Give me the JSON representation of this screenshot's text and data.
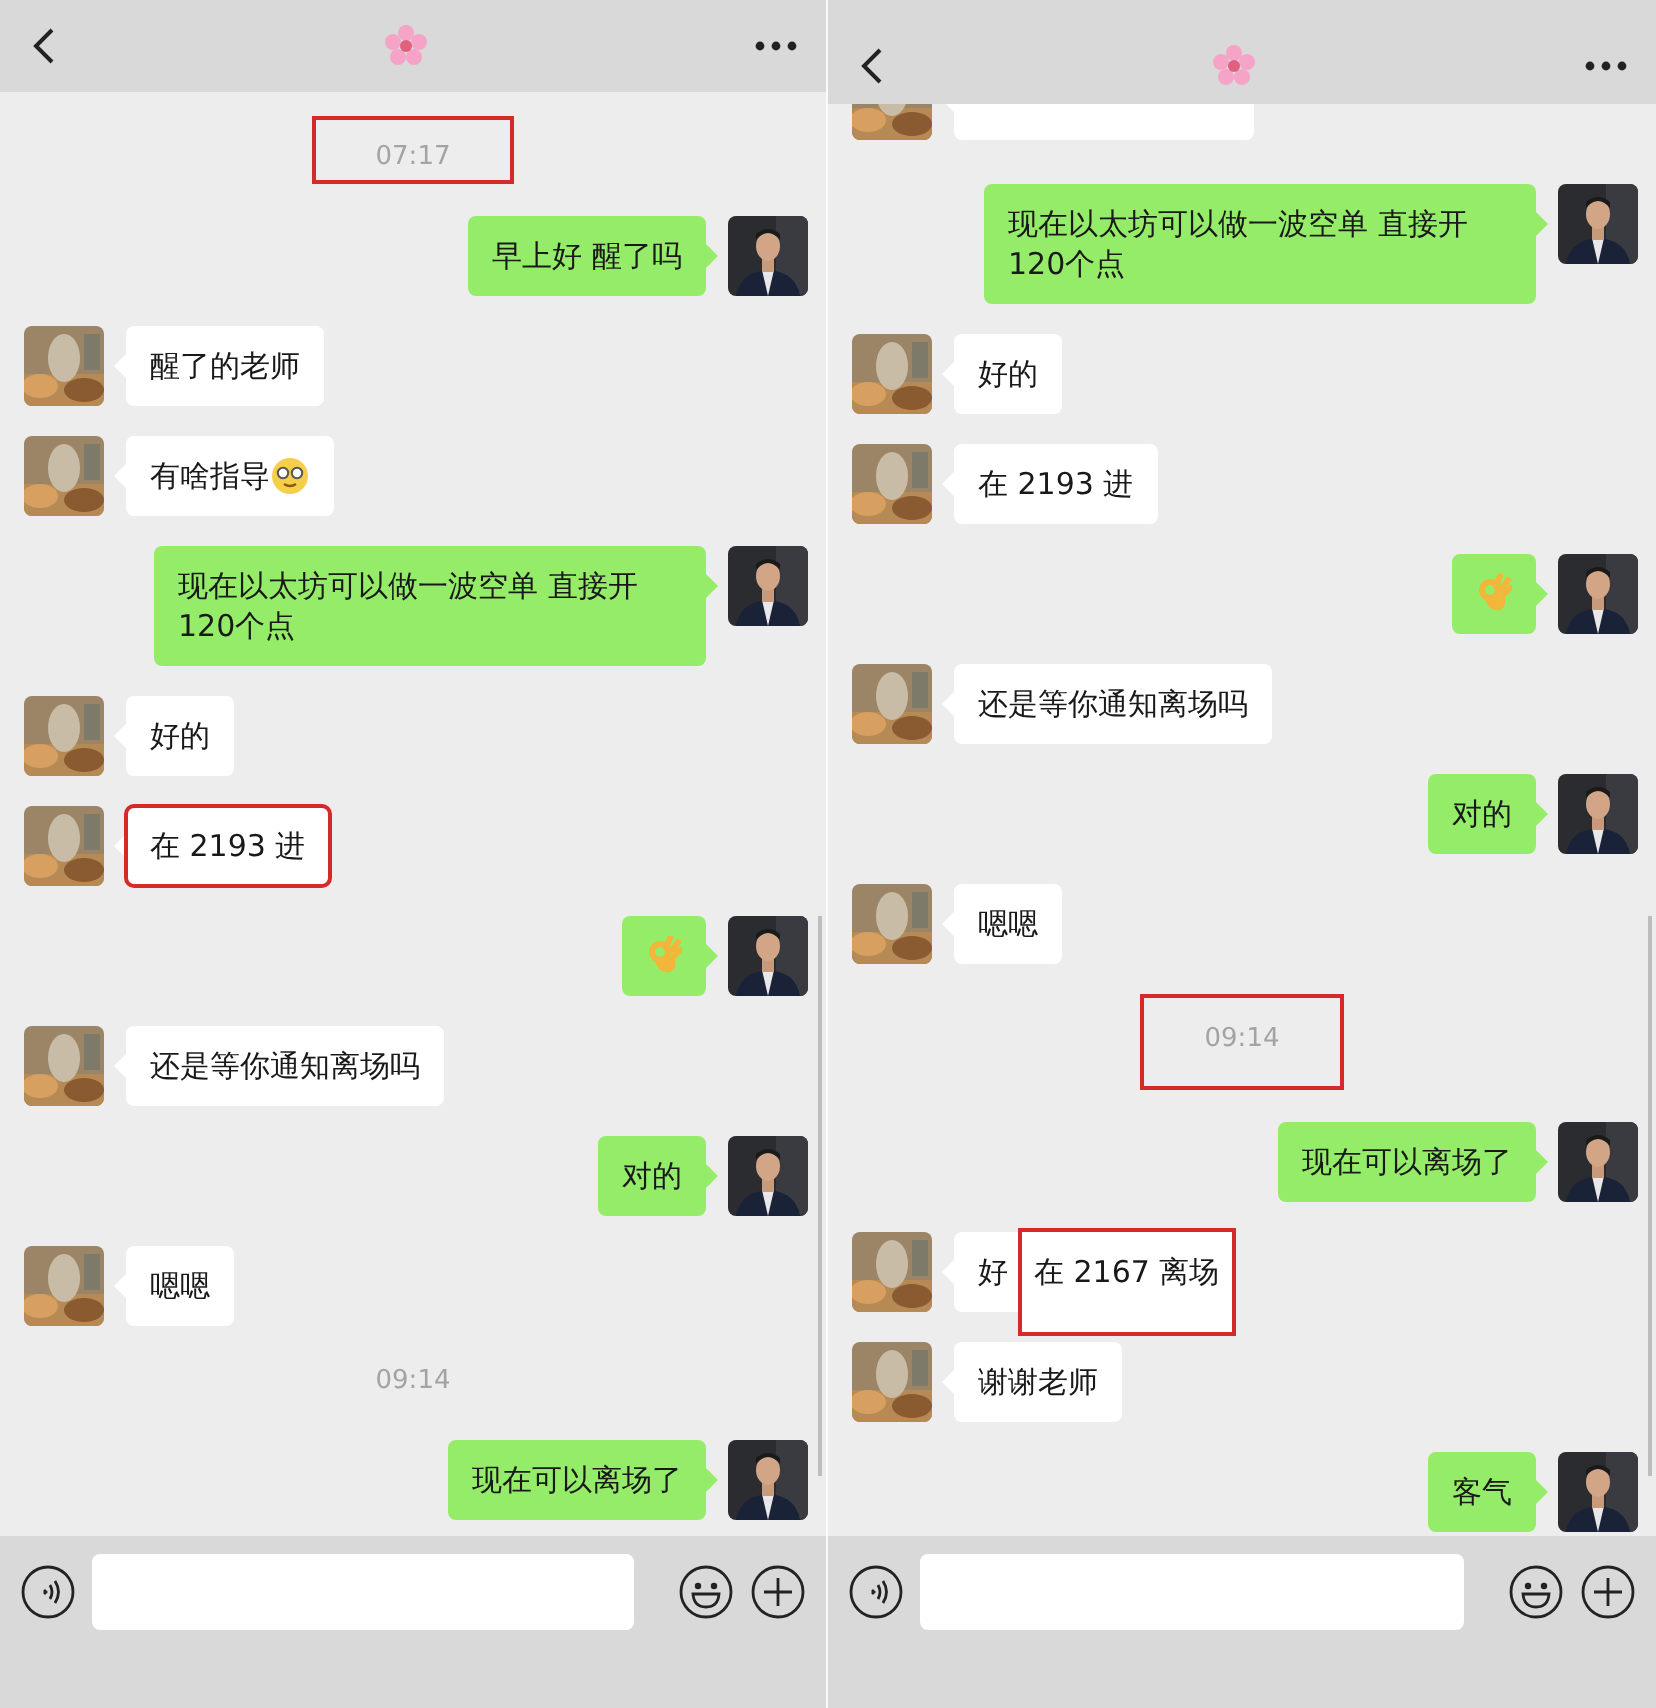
{
  "panels": [
    {
      "messages": [
        {
          "kind": "time",
          "text": "07:17",
          "highlighted": true
        },
        {
          "kind": "out",
          "text": "早上好 醒了吗"
        },
        {
          "kind": "in",
          "text": "醒了的老师"
        },
        {
          "kind": "in_emoji",
          "text": "有啥指导"
        },
        {
          "kind": "out",
          "text": "现在以太坊可以做一波空单 直接开120个点"
        },
        {
          "kind": "in",
          "text": "好的"
        },
        {
          "kind": "in",
          "text": "在 2193 进",
          "highlighted": true
        },
        {
          "kind": "out_ok"
        },
        {
          "kind": "in",
          "text": "还是等你通知离场吗"
        },
        {
          "kind": "out",
          "text": "对的"
        },
        {
          "kind": "in",
          "text": "嗯嗯"
        },
        {
          "kind": "time",
          "text": "09:14"
        },
        {
          "kind": "out",
          "text": "现在可以离场了"
        }
      ]
    },
    {
      "messages": [
        {
          "kind": "cut"
        },
        {
          "kind": "out",
          "text": "现在以太坊可以做一波空单 直接开120个点"
        },
        {
          "kind": "in",
          "text": "好的"
        },
        {
          "kind": "in",
          "text": "在 2193 进"
        },
        {
          "kind": "out_ok"
        },
        {
          "kind": "in",
          "text": "还是等你通知离场吗"
        },
        {
          "kind": "out",
          "text": "对的"
        },
        {
          "kind": "in",
          "text": "嗯嗯"
        },
        {
          "kind": "time",
          "text": "09:14",
          "highlighted": true
        },
        {
          "kind": "out",
          "text": "现在可以离场了"
        },
        {
          "kind": "in",
          "text": "好",
          "overlay": "在 2167 离场"
        },
        {
          "kind": "in",
          "text": "谢谢老师"
        },
        {
          "kind": "out",
          "text": "客气"
        }
      ]
    }
  ]
}
